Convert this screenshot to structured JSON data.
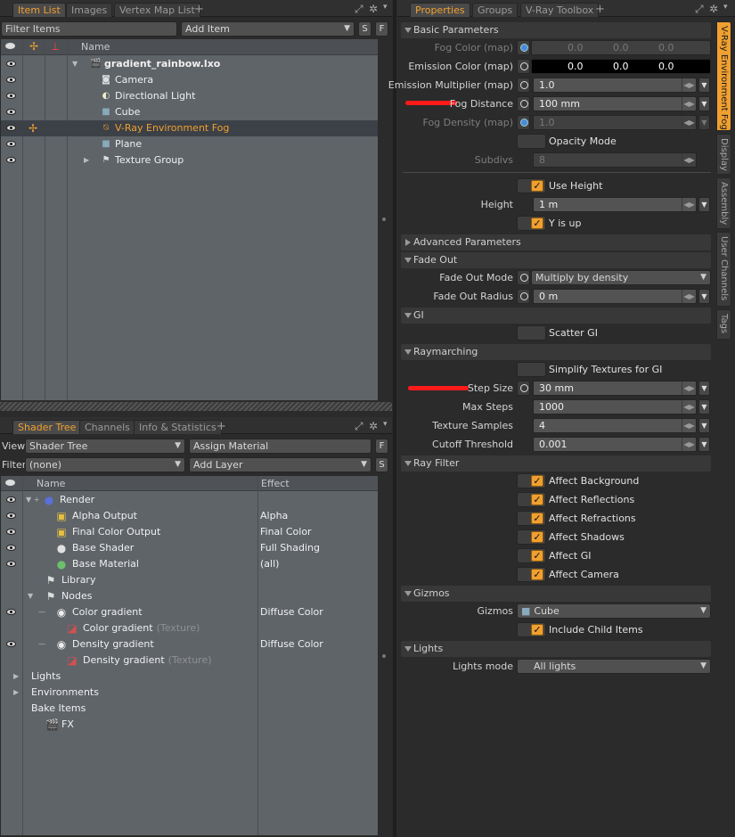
{
  "item_list": {
    "tabs": [
      "Item List",
      "Images",
      "Vertex Map List"
    ],
    "filter_placeholder": "Filter Items",
    "add_item": "Add Item",
    "s_btn": "S",
    "f_btn": "F",
    "col_name": "Name",
    "items": [
      {
        "label": "gradient_rainbow.lxo",
        "icon": "scene-icon"
      },
      {
        "label": "Camera",
        "icon": "camera-icon"
      },
      {
        "label": "Directional Light",
        "icon": "light-icon"
      },
      {
        "label": "Cube",
        "icon": "mesh-icon"
      },
      {
        "label": "V-Ray Environment Fog",
        "icon": "fog-icon"
      },
      {
        "label": "Plane",
        "icon": "mesh-icon"
      },
      {
        "label": "Texture Group",
        "icon": "group-icon"
      }
    ]
  },
  "shader_tree": {
    "tabs": [
      "Shader Tree",
      "Channels",
      "Info & Statistics"
    ],
    "view_label": "View",
    "view_value": "Shader Tree",
    "assign_material": "Assign Material",
    "filter_label": "Filter",
    "filter_value": "(none)",
    "add_layer": "Add Layer",
    "f_btn": "F",
    "s_btn": "S",
    "col_name": "Name",
    "col_effect": "Effect",
    "rows": [
      {
        "name": "Render",
        "suffix": "",
        "effect": ""
      },
      {
        "name": "Alpha Output",
        "suffix": "",
        "effect": "Alpha"
      },
      {
        "name": "Final Color Output",
        "suffix": "",
        "effect": "Final Color"
      },
      {
        "name": "Base Shader",
        "suffix": "",
        "effect": "Full Shading"
      },
      {
        "name": "Base Material",
        "suffix": "",
        "effect": "(all)"
      },
      {
        "name": "Library",
        "suffix": "",
        "effect": ""
      },
      {
        "name": "Nodes",
        "suffix": "",
        "effect": ""
      },
      {
        "name": "Color gradient",
        "suffix": "",
        "effect": "Diffuse Color"
      },
      {
        "name": "Color gradient",
        "suffix": "(Texture)",
        "effect": ""
      },
      {
        "name": "Density gradient",
        "suffix": "",
        "effect": "Diffuse Color"
      },
      {
        "name": "Density gradient",
        "suffix": "(Texture)",
        "effect": ""
      },
      {
        "name": "Lights",
        "suffix": "",
        "effect": ""
      },
      {
        "name": "Environments",
        "suffix": "",
        "effect": ""
      },
      {
        "name": "Bake Items",
        "suffix": "",
        "effect": ""
      },
      {
        "name": "FX",
        "suffix": "",
        "effect": ""
      }
    ]
  },
  "properties": {
    "tabs": [
      "Properties",
      "Groups",
      "V-Ray Toolbox"
    ],
    "side_tabs": [
      "V-Ray Environment Fog",
      "Display",
      "Assembly",
      "User Channels",
      "Tags"
    ],
    "sections": {
      "basic": "Basic Parameters",
      "advanced": "Advanced Parameters",
      "fade": "Fade Out",
      "gi": "GI",
      "ray": "Raymarching",
      "rayfilter": "Ray Filter",
      "gizmos": "Gizmos",
      "lights": "Lights"
    },
    "fog_color_label": "Fog Color (map)",
    "fog_color": [
      "0.0",
      "0.0",
      "0.0"
    ],
    "emission_color_label": "Emission Color (map)",
    "emission_color": [
      "0.0",
      "0.0",
      "0.0"
    ],
    "emission_mult_label": "Emission Multiplier (map)",
    "emission_mult": "1.0",
    "fog_distance_label": "Fog Distance",
    "fog_distance": "100 mm",
    "fog_density_label": "Fog Density (map)",
    "fog_density": "1.0",
    "opacity_mode": "Opacity Mode",
    "subdivs_label": "Subdivs",
    "subdivs": "8",
    "use_height": "Use Height",
    "height_label": "Height",
    "height": "1 m",
    "y_is_up": "Y is up",
    "fade_mode_label": "Fade Out Mode",
    "fade_mode": "Multiply by density",
    "fade_radius_label": "Fade Out Radius",
    "fade_radius": "0 m",
    "scatter_gi": "Scatter GI",
    "simplify": "Simplify Textures for GI",
    "step_size_label": "Step Size",
    "step_size": "30 mm",
    "max_steps_label": "Max Steps",
    "max_steps": "1000",
    "tex_samples_label": "Texture Samples",
    "tex_samples": "4",
    "cutoff_label": "Cutoff Threshold",
    "cutoff": "0.001",
    "affect": [
      "Affect Background",
      "Affect Reflections",
      "Affect Refractions",
      "Affect Shadows",
      "Affect GI",
      "Affect Camera"
    ],
    "gizmos_label": "Gizmos",
    "gizmos_value": "Cube",
    "include_child": "Include Child Items",
    "lights_mode_label": "Lights mode",
    "lights_mode": "All lights"
  },
  "colors": {
    "accent": "#f0a030",
    "selected_text": "#f0a030",
    "highlight_mark": "#ff1a1a"
  }
}
